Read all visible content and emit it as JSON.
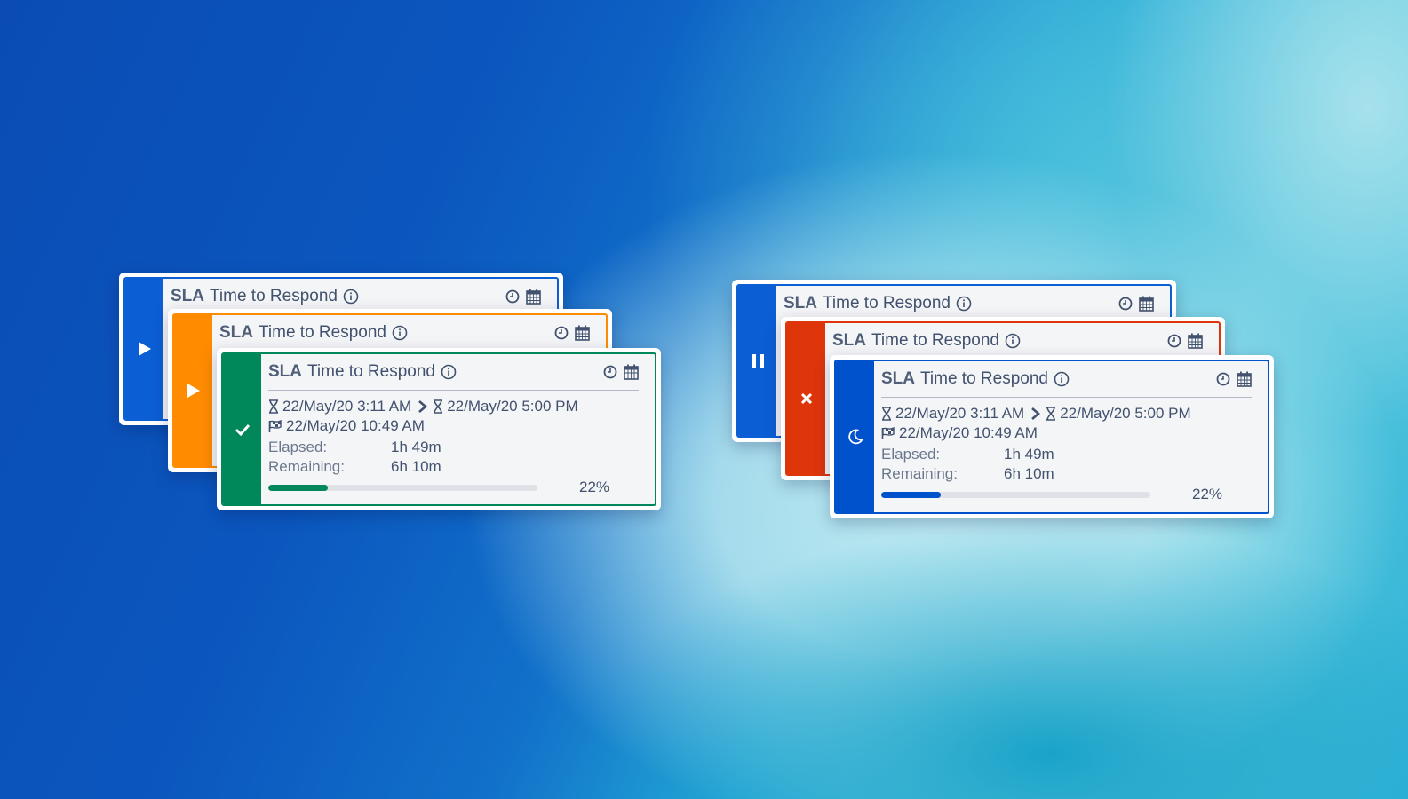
{
  "colors": {
    "blue": "#0c5ed4",
    "orange": "#ff8b00",
    "green": "#00875a",
    "red": "#de350b",
    "navy_blue": "#0052cc"
  },
  "cards": [
    {
      "prefix": "SLA",
      "title": "Time to Respond",
      "status_icon": "play-icon"
    },
    {
      "prefix": "SLA",
      "title": "Time to Respond",
      "status_icon": "play-icon"
    },
    {
      "prefix": "SLA",
      "title": "Time to Respond",
      "status_icon": "check-icon",
      "start": "22/May/20 3:11 AM",
      "due": "22/May/20 5:00 PM",
      "finish": "22/May/20 10:49 AM",
      "elapsed_label": "Elapsed:",
      "elapsed": "1h 49m",
      "remaining_label": "Remaining:",
      "remaining": "6h 10m",
      "progress": 0.22,
      "progress_label": "22%"
    },
    {
      "prefix": "SLA",
      "title": "Time to Respond",
      "status_icon": "pause-icon"
    },
    {
      "prefix": "SLA",
      "title": "Time to Respond",
      "status_icon": "close-icon"
    },
    {
      "prefix": "SLA",
      "title": "Time to Respond",
      "status_icon": "moon-icon",
      "start": "22/May/20 3:11 AM",
      "due": "22/May/20 5:00 PM",
      "finish": "22/May/20 10:49 AM",
      "elapsed_label": "Elapsed:",
      "elapsed": "1h 49m",
      "remaining_label": "Remaining:",
      "remaining": "6h 10m",
      "progress": 0.22,
      "progress_label": "22%"
    }
  ]
}
